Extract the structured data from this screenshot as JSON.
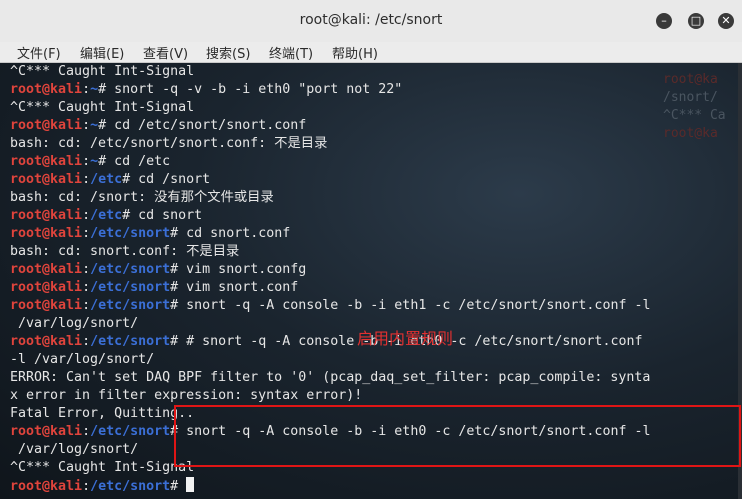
{
  "window": {
    "title": "root@kali: /etc/snort"
  },
  "menu": [
    "文件(F)",
    "编辑(E)",
    "查看(V)",
    "搜索(S)",
    "终端(T)",
    "帮助(H)"
  ],
  "background_text": [
    "root@ka",
    "/snort/",
    "^C*** Ca",
    "root@ka"
  ],
  "lines": [
    {
      "user": "",
      "path": "",
      "text": "^C*** Caught Int-Signal"
    },
    {
      "user": "root@kali",
      "path": ":~#",
      "text": " snort -q -v -b -i eth0 \"port not 22\""
    },
    {
      "user": "",
      "path": "",
      "text": "^C*** Caught Int-Signal"
    },
    {
      "user": "root@kali",
      "path": ":~#",
      "text": " cd /etc/snort/snort.conf"
    },
    {
      "user": "",
      "path": "",
      "text": "bash: cd: /etc/snort/snort.conf: 不是目录"
    },
    {
      "user": "root@kali",
      "path": ":~#",
      "text": " cd /etc"
    },
    {
      "user": "root@kali",
      "path": ":/etc#",
      "text": " cd /snort"
    },
    {
      "user": "",
      "path": "",
      "text": "bash: cd: /snort: 没有那个文件或目录"
    },
    {
      "user": "root@kali",
      "path": ":/etc#",
      "text": " cd snort"
    },
    {
      "user": "root@kali",
      "path": ":/etc/snort#",
      "text": " cd snort.conf"
    },
    {
      "user": "",
      "path": "",
      "text": "bash: cd: snort.conf: 不是目录"
    },
    {
      "user": "root@kali",
      "path": ":/etc/snort#",
      "text": " vim snort.confg"
    },
    {
      "user": "root@kali",
      "path": ":/etc/snort#",
      "text": " vim snort.conf"
    },
    {
      "user": "root@kali",
      "path": ":/etc/snort#",
      "text": " snort -q -A console -b -i eth1 -c /etc/snort/snort.conf -l"
    },
    {
      "user": "",
      "path": "",
      "text": " /var/log/snort/"
    },
    {
      "user": "root@kali",
      "path": ":/etc/snort#",
      "text": " # snort -q -A console -b -i eth0 -c /etc/snort/snort.conf"
    },
    {
      "user": "",
      "path": "",
      "text": "-l /var/log/snort/"
    },
    {
      "user": "",
      "path": "",
      "text": "ERROR: Can't set DAQ BPF filter to '0' (pcap_daq_set_filter: pcap_compile: synta"
    },
    {
      "user": "",
      "path": "",
      "text": "x error in filter expression: syntax error)!"
    },
    {
      "user": "",
      "path": "",
      "text": "Fatal Error, Quitting.."
    },
    {
      "user": "root@kali",
      "path": ":/etc/snort#",
      "text": " snort -q -A console -b -i eth0 -c /etc/snort/snort.conf -l"
    },
    {
      "user": "",
      "path": "",
      "text": " /var/log/snort/"
    },
    {
      "user": "",
      "path": "",
      "text": "^C*** Caught Int-Signal"
    },
    {
      "user": "root@kali",
      "path": ":/etc/snort#",
      "text": " "
    }
  ],
  "annotation": "启用内置规则",
  "colors": {
    "prompt_user": "#e0443c",
    "prompt_path": "#3b6fd6",
    "highlight_box": "#e01515"
  }
}
